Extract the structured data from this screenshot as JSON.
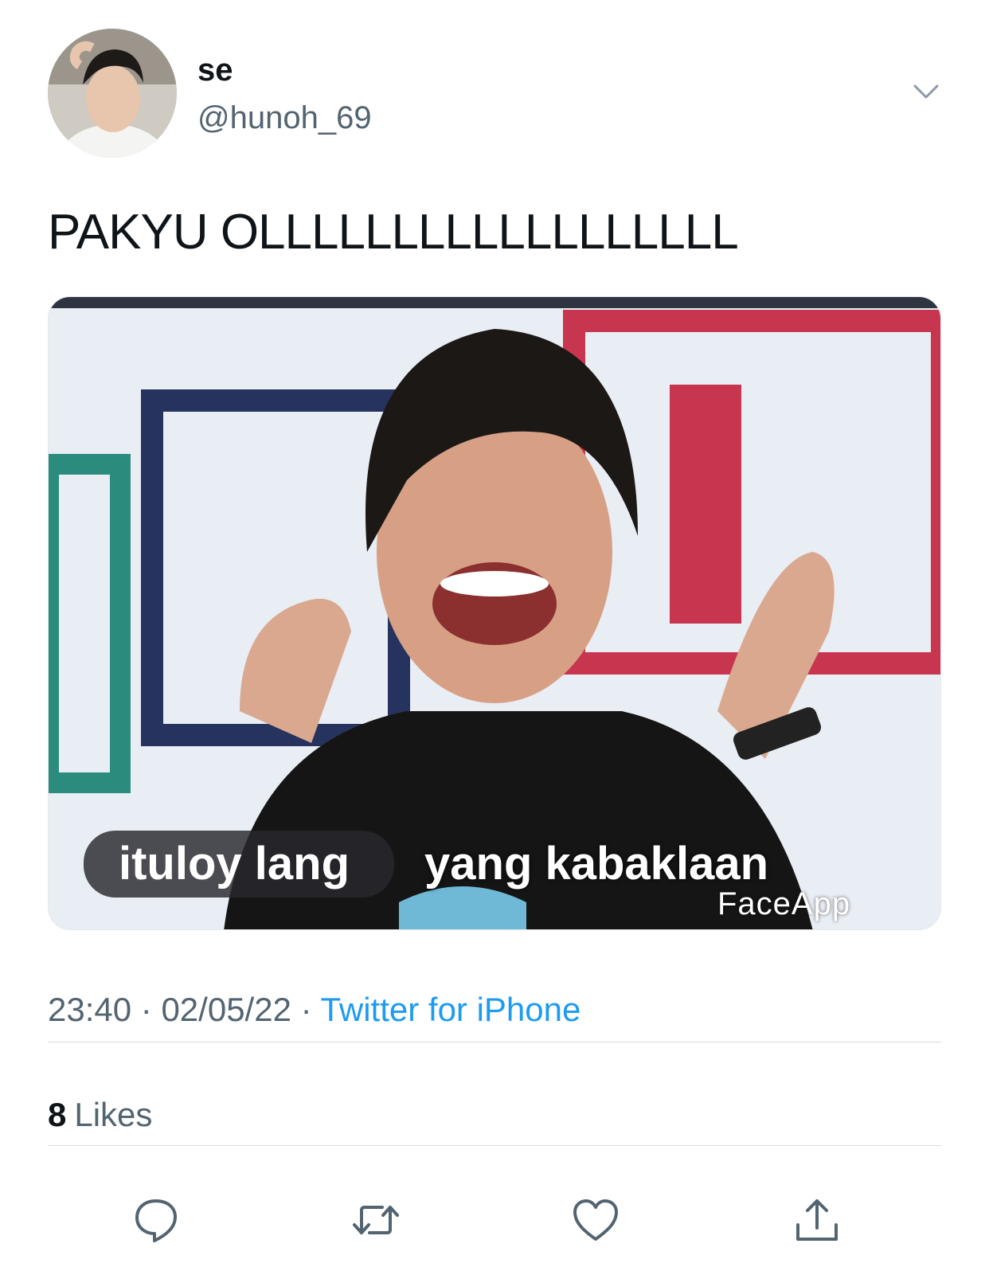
{
  "author": {
    "display_name": "se",
    "handle": "@hunoh_69"
  },
  "tweet": {
    "text": "PAKYU OLLLLLLLLLLLLLLLLLL"
  },
  "media": {
    "caption_left": "ituloy lang",
    "caption_right": "yang kabaklaan",
    "watermark": "FaceApp"
  },
  "meta": {
    "time": "23:40",
    "separator": "·",
    "date": "02/05/22",
    "source": "Twitter for iPhone"
  },
  "stats": {
    "likes_count": "8",
    "likes_label": "Likes"
  },
  "icons": {
    "more": "chevron-down-icon",
    "reply": "reply-icon",
    "retweet": "retweet-icon",
    "like": "heart-icon",
    "share": "share-icon"
  },
  "colors": {
    "text_primary": "#0f1419",
    "text_secondary": "#536471",
    "link": "#1d9bf0",
    "divider": "#d6dbe0"
  }
}
